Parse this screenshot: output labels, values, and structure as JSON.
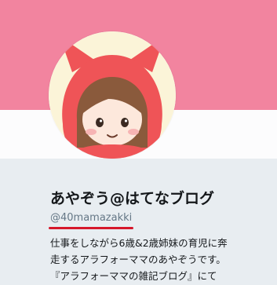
{
  "profile": {
    "display_name": "あやぞう@はてなブログ",
    "handle": "@40mamazakki",
    "bio_lines": [
      "仕事をしながら6歳&2歳姉妹の育児に奔",
      "走するアラフォーママのあやぞうです。",
      "『アラフォーママの雑記ブログ』にて"
    ],
    "avatar_icon": "devil-hood-character-icon"
  },
  "colors": {
    "banner": "#f2849f",
    "card_background": "#e8edf1",
    "handle_underline": "#d6182b",
    "avatar_hood": "#ef5457"
  }
}
